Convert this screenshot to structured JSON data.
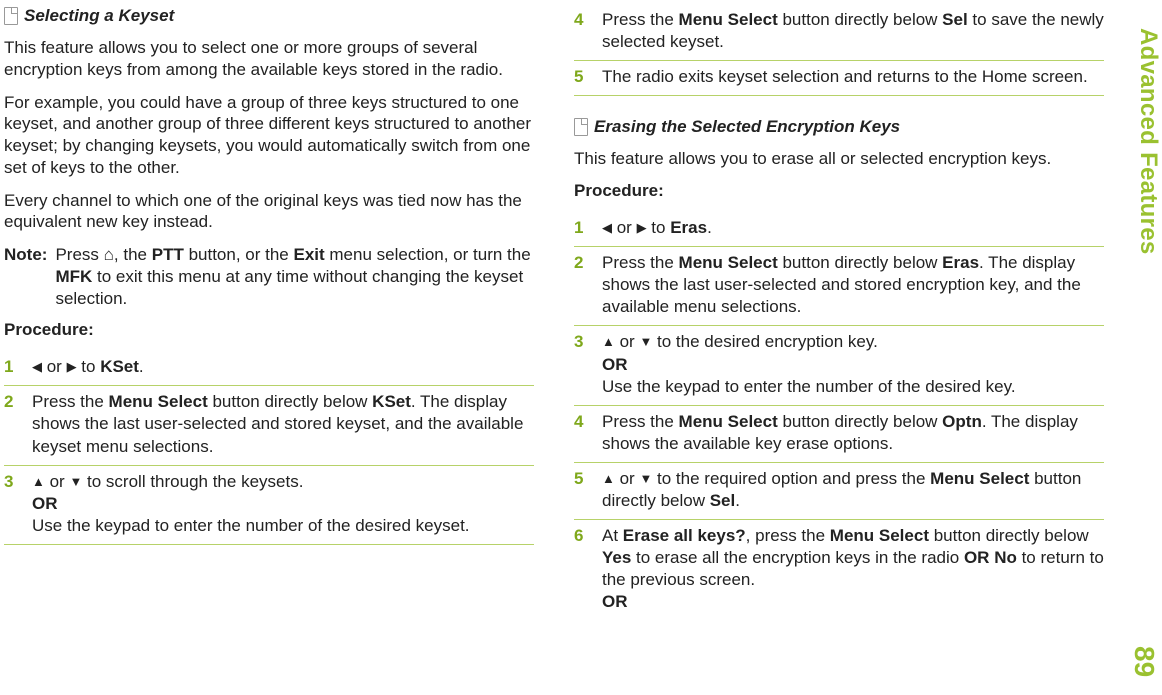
{
  "sidebar": {
    "tab": "Advanced Features",
    "page_number": "89"
  },
  "left": {
    "heading": "Selecting a Keyset",
    "para1": "This feature allows you to select one or more groups of several encryption keys from among the available keys stored in the radio.",
    "para2": "For example, you could have a group of three keys structured to one keyset, and another group of three different keys structured to another keyset; by changing keysets, you would automatically switch from one set of keys to the other.",
    "para3": "Every channel to which one of the original keys was tied now has the equivalent new key instead.",
    "note_label": "Note:",
    "note_pre": "Press ",
    "home_glyph": "⌂",
    "note_mid1": ", the ",
    "ptt": "PTT",
    "note_mid2": " button, or the ",
    "exit": "Exit",
    "note_mid3": " menu selection, or turn the ",
    "mfk": "MFK",
    "note_end": " to exit this menu at any time without changing the keyset selection.",
    "procedure": "Procedure:",
    "steps": {
      "s1": {
        "left_tri": "◀",
        "or1": " or ",
        "right_tri": "▶",
        "to": " to ",
        "kset": "KSet",
        "dot": "."
      },
      "s2": {
        "pre": "Press the ",
        "ms": "Menu Select",
        "mid": " button directly below ",
        "kset": "KSet",
        "post": ". The display shows the last user-selected and stored keyset, and the available keyset menu selections."
      },
      "s3": {
        "up": "▲",
        "or": " or ",
        "down": "▼",
        "post": " to scroll through the keysets.",
        "or_line": "OR",
        "alt": "Use the keypad to enter the number of the desired keyset."
      }
    }
  },
  "right": {
    "steps_top": {
      "s4": {
        "pre": "Press the ",
        "ms": "Menu Select",
        "mid": " button directly below ",
        "sel": "Sel",
        "post": " to save the newly selected keyset."
      },
      "s5": {
        "text": "The radio exits keyset selection and returns to the Home screen."
      }
    },
    "heading": "Erasing the Selected Encryption Keys",
    "para1": "This feature allows you to erase all or selected encryption keys.",
    "procedure": "Procedure:",
    "steps": {
      "s1": {
        "left_tri": "◀",
        "or1": " or ",
        "right_tri": "▶",
        "to": " to ",
        "eras": "Eras",
        "dot": "."
      },
      "s2": {
        "pre": "Press the ",
        "ms": "Menu Select",
        "mid": " button directly below ",
        "eras": "Eras",
        "post": ". The display shows the last user-selected and stored encryption key, and the available menu selections."
      },
      "s3": {
        "up": "▲",
        "or": " or ",
        "down": "▼",
        "post": " to the desired encryption key.",
        "or_line": "OR",
        "alt": "Use the keypad to enter the number of the desired key."
      },
      "s4": {
        "pre": "Press the ",
        "ms": "Menu Select",
        "mid": " button directly below ",
        "optn": "Optn",
        "post": ". The display shows the available key erase options."
      },
      "s5": {
        "up": "▲",
        "or": " or ",
        "down": "▼",
        "mid": " to the required option and press the ",
        "ms": "Menu Select",
        "mid2": " button directly below ",
        "sel": "Sel",
        "dot": "."
      },
      "s6": {
        "at": "At ",
        "prompt": "Erase all keys?",
        "pre": ", press the ",
        "ms": "Menu Select",
        "mid": " button directly below ",
        "yes": "Yes",
        "mid2": " to erase all the encryption keys in the radio ",
        "OR1": "OR",
        "sp": " ",
        "no": "No",
        "mid3": " to return to the previous screen.",
        "or_line": "OR"
      }
    }
  }
}
